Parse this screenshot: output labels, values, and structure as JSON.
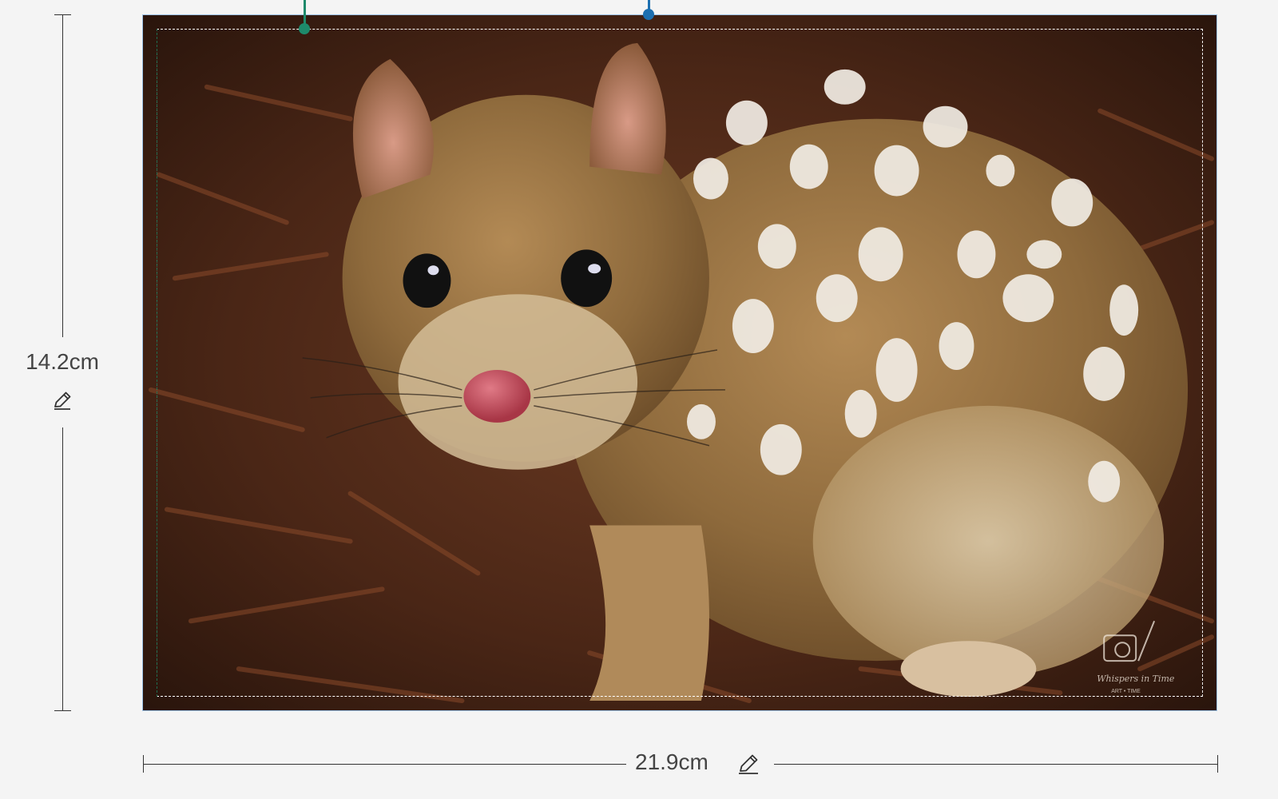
{
  "dimensions": {
    "height_label": "14.2cm",
    "width_label": "21.9cm"
  },
  "icons": {
    "edit_height": "pencil-icon",
    "edit_width": "pencil-icon"
  },
  "photo": {
    "watermark_text": "Whispers in Time",
    "watermark_sub": "ART • TIME"
  },
  "colors": {
    "frame_border": "#9ec3e6",
    "handle_green": "#1e8a6b",
    "handle_blue": "#1c6fb0"
  }
}
